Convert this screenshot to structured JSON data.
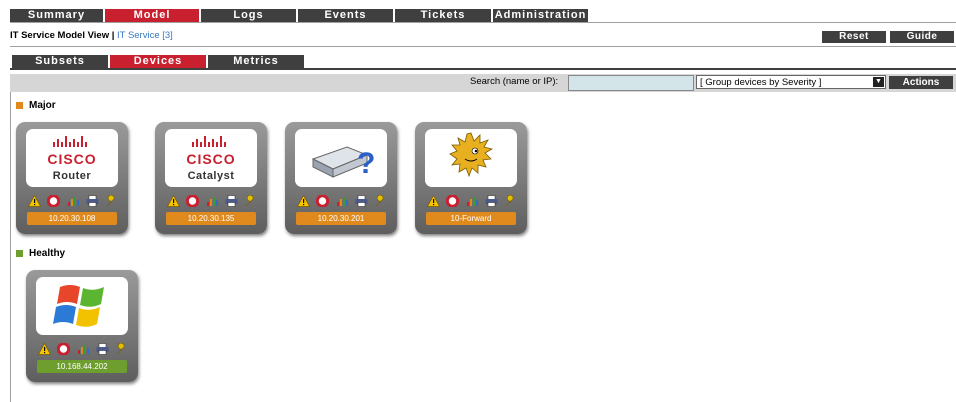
{
  "top_nav": {
    "tabs": [
      {
        "label": "Summary",
        "active": false
      },
      {
        "label": "Model",
        "active": true
      },
      {
        "label": "Logs",
        "active": false
      },
      {
        "label": "Events",
        "active": false
      },
      {
        "label": "Tickets",
        "active": false
      },
      {
        "label": "Administration",
        "active": false
      }
    ]
  },
  "header": {
    "title": "IT Service Model View | ",
    "link": "IT Service [3]",
    "reset_label": "Reset",
    "guide_label": "Guide"
  },
  "sub_tabs": [
    {
      "label": "Subsets",
      "active": false
    },
    {
      "label": "Devices",
      "active": true
    },
    {
      "label": "Metrics",
      "active": false
    }
  ],
  "search": {
    "label": "Search (name or IP):",
    "value": "",
    "group_select": "[ Group devices by Severity ]",
    "actions_label": "Actions"
  },
  "colors": {
    "major": "#e08a1e",
    "healthy": "#6e9e2e",
    "active_tab": "#c8202f",
    "tab": "#3f3f3f"
  },
  "groups": [
    {
      "label": "Major",
      "devices": [
        {
          "icon": "cisco-logo",
          "logo_text": "CISCO",
          "name": "Router",
          "ip": "10.20.30.108"
        },
        {
          "icon": "cisco-logo",
          "logo_text": "CISCO",
          "name": "Catalyst",
          "ip": "10.20.30.135"
        },
        {
          "icon": "unknown-device-icon",
          "ip": "10.20.30.201"
        },
        {
          "icon": "pufferfish-icon",
          "ip": "10-Forward"
        }
      ]
    },
    {
      "label": "Healthy",
      "devices": [
        {
          "icon": "windows-logo",
          "ip": "10.168.44.202"
        }
      ]
    }
  ]
}
